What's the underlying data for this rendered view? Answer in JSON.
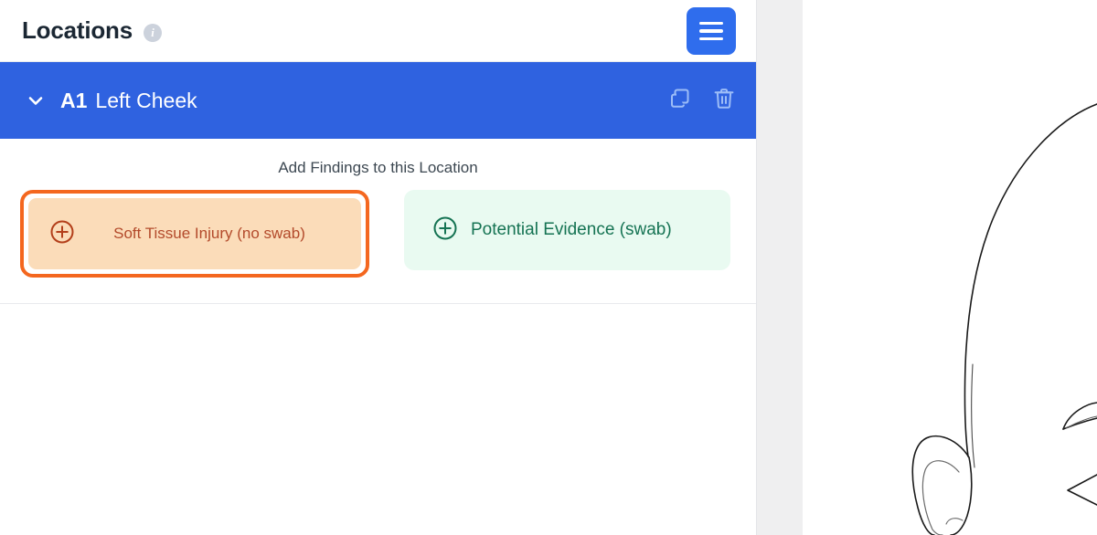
{
  "panel": {
    "header": {
      "title": "Locations",
      "info_icon": "info-circle-icon",
      "menu_icon": "hamburger-menu-icon",
      "accent_color": "#2f6ded"
    },
    "location": {
      "expanded": true,
      "chevron_icon": "chevron-down-icon",
      "code": "A1",
      "name": "Left Cheek",
      "row_color": "#2f62e0",
      "actions": [
        {
          "name": "duplicate-location",
          "icon": "copy-icon"
        },
        {
          "name": "delete-location",
          "icon": "trash-icon"
        }
      ]
    },
    "findings": {
      "label": "Add Findings to this Location",
      "options": [
        {
          "id": "soft-tissue-injury",
          "label": "Soft Tissue Injury (no swab)",
          "icon": "plus-circle-icon",
          "selected": true,
          "bg_color": "#fbdcb9",
          "text_color": "#b34a2b",
          "ring_color": "#f4671f"
        },
        {
          "id": "potential-evidence",
          "label": "Potential Evidence (swab)",
          "icon": "plus-circle-icon",
          "selected": false,
          "bg_color": "#e9faf1",
          "text_color": "#157353"
        }
      ]
    }
  },
  "canvas": {
    "name": "body-diagram-canvas",
    "illustration": "head-face-line-drawing",
    "gutter_color": "#efeff0",
    "line_color": "#1a1a1a"
  }
}
